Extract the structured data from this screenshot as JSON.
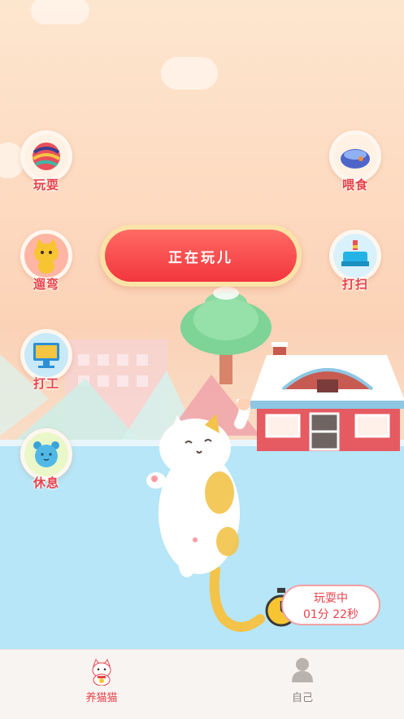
{
  "actions": {
    "play": "玩耍",
    "feed": "喂食",
    "walk": "遛弯",
    "clean": "打扫",
    "work": "打工",
    "rest": "休息"
  },
  "main_button": {
    "label": "正在玩儿"
  },
  "timer": {
    "status": "玩耍中",
    "elapsed": "01分 22秒"
  },
  "tabbar": {
    "tabs": [
      {
        "label": "养猫猫",
        "active": true,
        "icon": "lucky-cat-icon"
      },
      {
        "label": "自己",
        "active": false,
        "icon": "user-icon"
      }
    ]
  },
  "colors": {
    "accent": "#e8424c",
    "button": "#f2363e",
    "sky": "#fde6cf",
    "ground": "#b6e6f7"
  }
}
